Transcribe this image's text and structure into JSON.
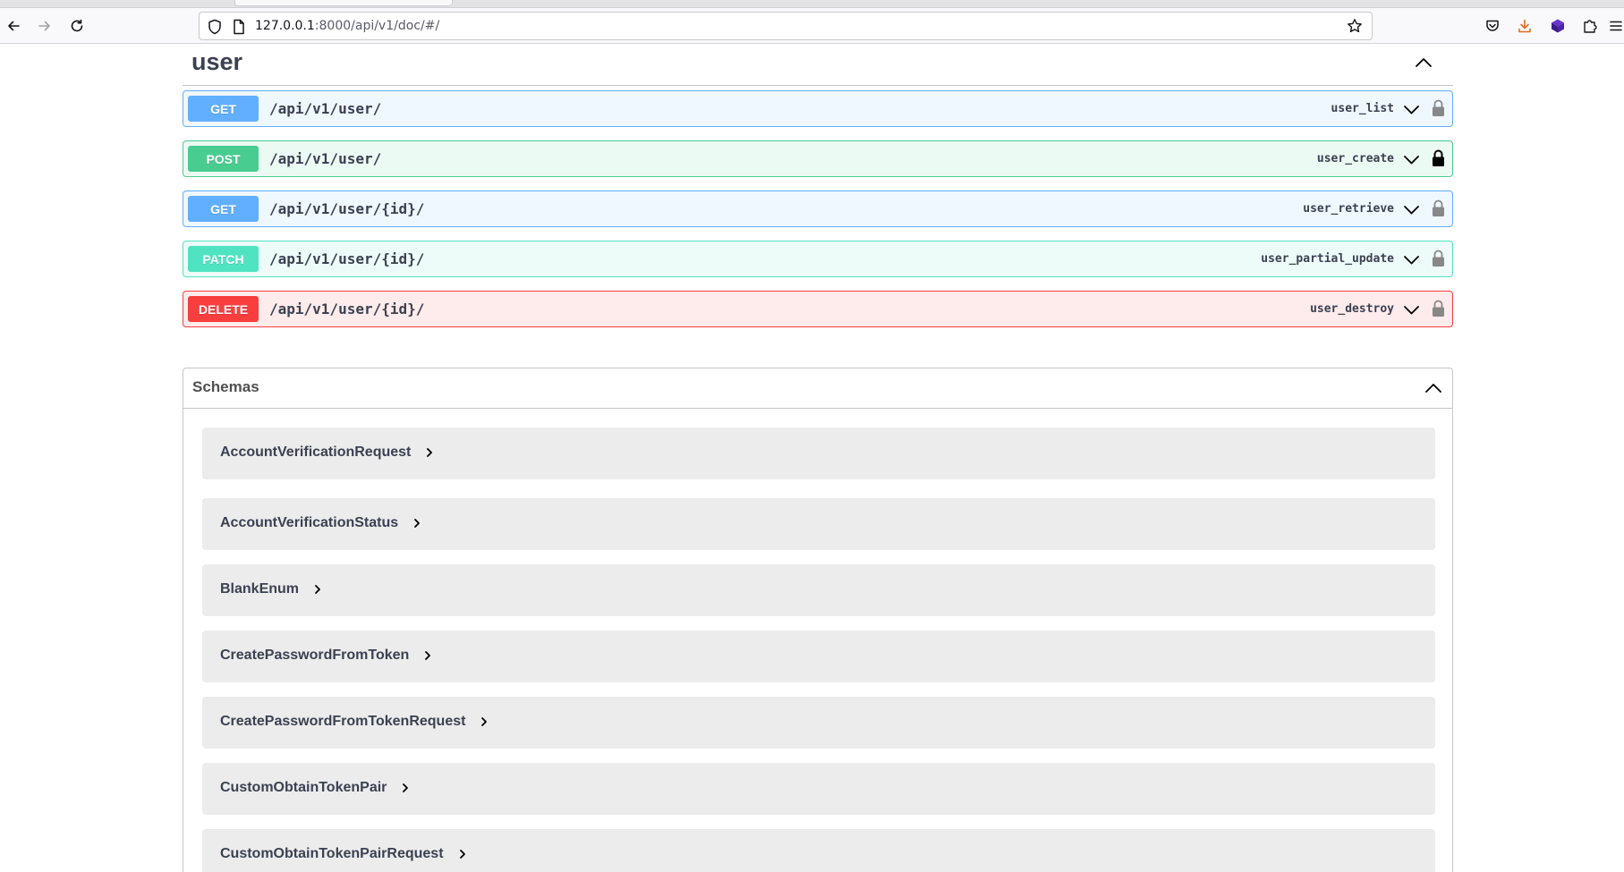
{
  "browser": {
    "url_host": "127.0.0.1",
    "url_path": ":8000/api/v1/doc/#/"
  },
  "tag": {
    "title": "user"
  },
  "operations": [
    {
      "method": "GET",
      "path": "/api/v1/user/",
      "operation_id": "user_list",
      "locked": false
    },
    {
      "method": "POST",
      "path": "/api/v1/user/",
      "operation_id": "user_create",
      "locked": true
    },
    {
      "method": "GET",
      "path": "/api/v1/user/{id}/",
      "operation_id": "user_retrieve",
      "locked": false
    },
    {
      "method": "PATCH",
      "path": "/api/v1/user/{id}/",
      "operation_id": "user_partial_update",
      "locked": false
    },
    {
      "method": "DELETE",
      "path": "/api/v1/user/{id}/",
      "operation_id": "user_destroy",
      "locked": false
    }
  ],
  "schemas": {
    "title": "Schemas",
    "models": [
      "AccountVerificationRequest",
      "AccountVerificationStatus",
      "BlankEnum",
      "CreatePasswordFromToken",
      "CreatePasswordFromTokenRequest",
      "CustomObtainTokenPair",
      "CustomObtainTokenPairRequest"
    ]
  },
  "colors": {
    "get": "#61affe",
    "post": "#49cc90",
    "patch": "#50e3c2",
    "delete": "#f93e3e",
    "text": "#3b4151"
  }
}
